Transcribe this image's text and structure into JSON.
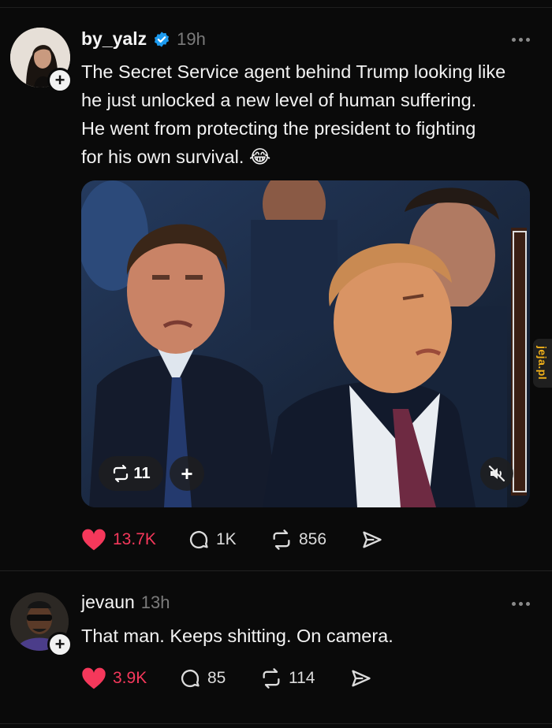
{
  "posts": [
    {
      "username": "by_yalz",
      "verified": true,
      "time": "19h",
      "text": "The Secret Service agent behind Trump looking like he just unlocked a new level of human suffering. He went from protecting the president to fighting for his own survival. 😂",
      "text_lines": [
        "The Secret Service agent behind Trump looking like",
        "he just unlocked a new level of human suffering.",
        "He went from protecting the president to fighting",
        "for his own survival. 😂"
      ],
      "media": {
        "repost_count": "11",
        "add_label": "+",
        "muted": true
      },
      "likes": "13.7K",
      "replies": "1K",
      "reposts": "856"
    },
    {
      "username": "jevaun",
      "verified": false,
      "time": "13h",
      "text": "That man. Keeps shitting. On camera.",
      "likes": "3.9K",
      "replies": "85",
      "reposts": "114"
    }
  ],
  "watermark": "jeja.pl",
  "colors": {
    "like": "#f5385b",
    "verified": "#1d9bf0",
    "background": "#0a0a0a"
  }
}
